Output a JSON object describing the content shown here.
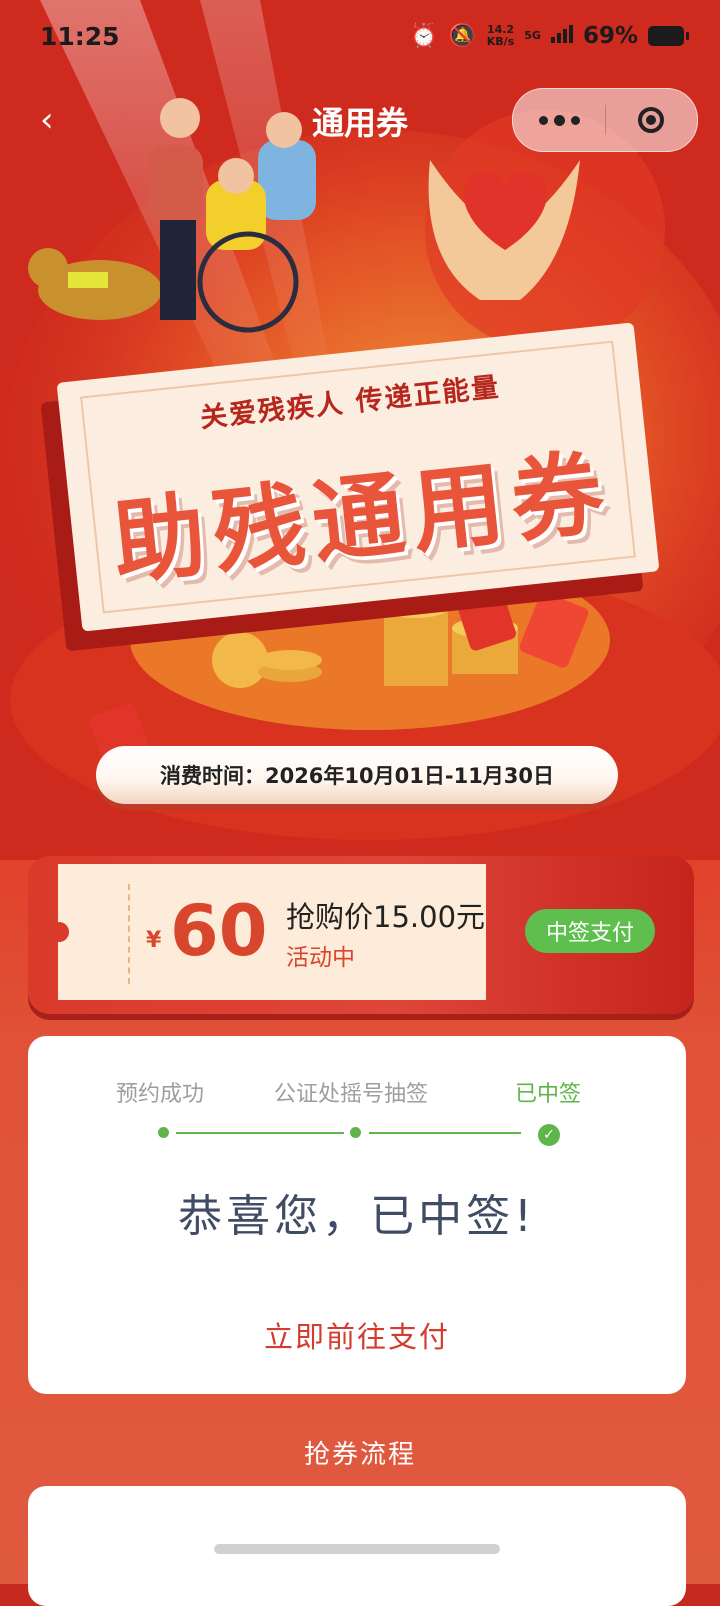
{
  "status_bar": {
    "time": "11:25",
    "net_speed": "14.2",
    "net_speed_unit": "KB/s",
    "network": "5G",
    "battery": "69%"
  },
  "nav": {
    "back_icon": "chevron-left-icon",
    "title": "通用券",
    "more_icon": "more-dots-icon",
    "close_icon": "target-close-icon"
  },
  "banner": {
    "slogan": "关爱残疾人  传递正能量",
    "title": "助残通用券"
  },
  "consume_time": "消费时间：2026年10月01日-11月30日",
  "coupon": {
    "currency": "¥",
    "amount": "60",
    "price_label": "抢购价15.00元",
    "status": "活动中",
    "action": "中签支付"
  },
  "progress": {
    "steps": [
      {
        "label": "预约成功",
        "state": "done"
      },
      {
        "label": "公证处摇号抽签",
        "state": "done"
      },
      {
        "label": "已中签",
        "state": "current"
      }
    ],
    "message": "恭喜您，已中签!",
    "action": "立即前往支付"
  },
  "flow_section": {
    "title": "抢券流程"
  },
  "colors": {
    "brand_red": "#d9462e",
    "success_green": "#5ebf4e",
    "text_dark": "#3f4c63"
  }
}
